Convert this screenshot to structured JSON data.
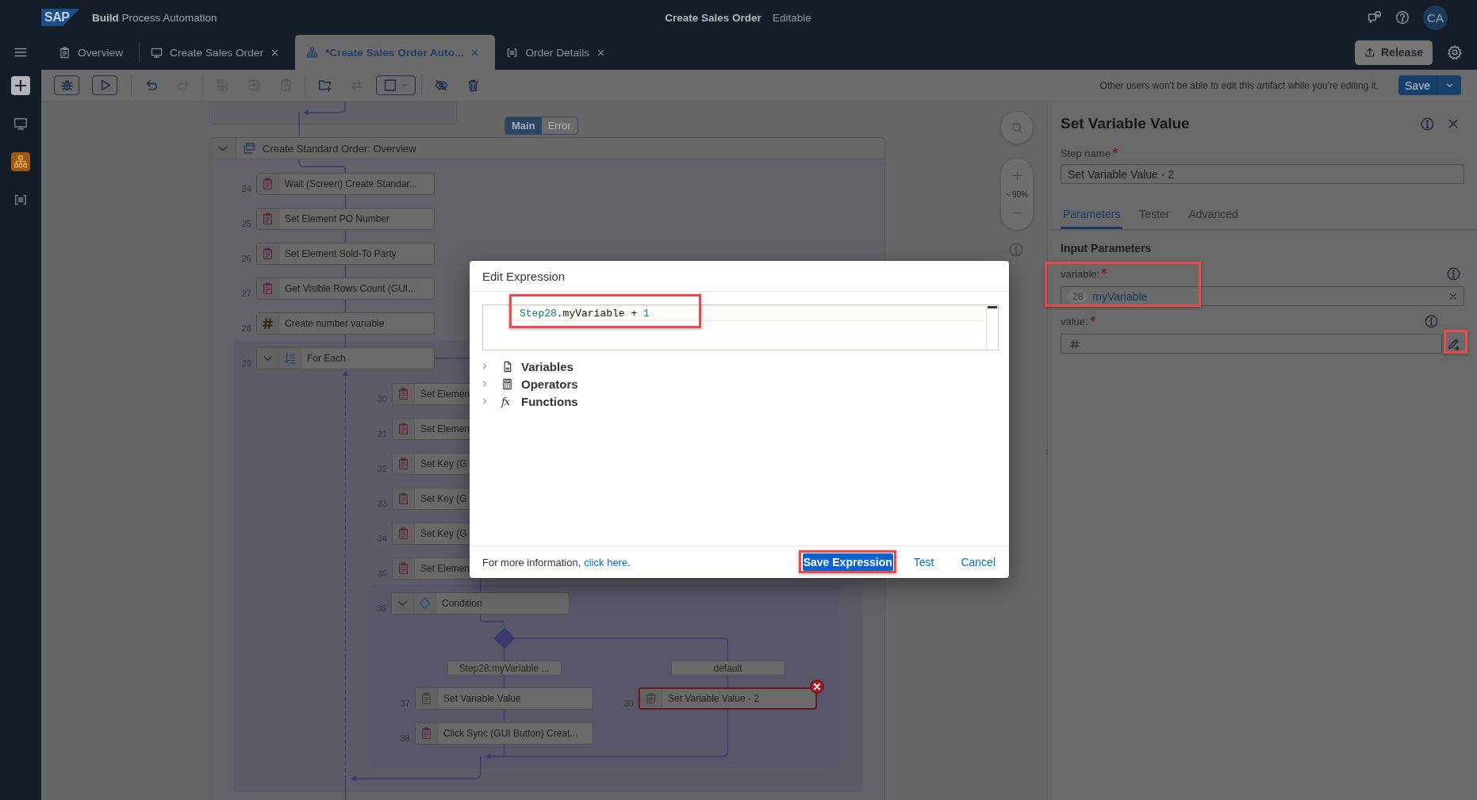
{
  "shell_bar": {
    "logo_text": "SAP",
    "product": "**Build** Process Automation",
    "document_title": "Create Sales Order",
    "document_status": "Editable",
    "user_initials": "CA"
  },
  "tabs": [
    {
      "label": "Overview",
      "kind": "overview",
      "selected": false,
      "closable": false
    },
    {
      "label": "Create Sales Order",
      "kind": "screen",
      "selected": false,
      "closable": true
    },
    {
      "label": "*Create Sales Order Auto...",
      "kind": "process",
      "selected": true,
      "closable": true
    },
    {
      "label": "Order Details",
      "kind": "data",
      "selected": false,
      "closable": true
    }
  ],
  "release_button": "Release",
  "sidebar": {
    "items": [
      {
        "kind": "add",
        "selected": false
      },
      {
        "kind": "screen",
        "selected": false
      },
      {
        "kind": "process",
        "selected": true
      },
      {
        "kind": "data",
        "selected": false
      }
    ]
  },
  "toolbar": {
    "groups": [
      [
        {
          "kind": "debug",
          "disabled": false
        },
        {
          "kind": "run",
          "disabled": false
        }
      ],
      [
        {
          "kind": "undo",
          "disabled": false
        },
        {
          "kind": "redo",
          "disabled": true
        }
      ],
      [
        {
          "kind": "copy",
          "disabled": true
        },
        {
          "kind": "duplicate",
          "disabled": true
        },
        {
          "kind": "paste",
          "disabled": true
        }
      ],
      [
        {
          "kind": "add_group",
          "disabled": false
        },
        {
          "kind": "swap",
          "disabled": true
        },
        {
          "kind": "select",
          "disabled": false
        }
      ],
      [
        {
          "kind": "hide",
          "disabled": false
        },
        {
          "kind": "delete",
          "disabled": false
        }
      ]
    ],
    "notice": "Other users won't be able to edit this artifact while you're editing it.",
    "save_button": "Save"
  },
  "canvas": {
    "view_switch": [
      {
        "label": "Main",
        "selected": true
      },
      {
        "label": "Error",
        "selected": false
      }
    ],
    "group": {
      "title": "Create Standard Order: Overview",
      "expanded": true,
      "steps": [
        {
          "number": "24",
          "kind": "activity",
          "label": "Wait (Screen) Create Standar..."
        },
        {
          "number": "25",
          "kind": "activity",
          "label": "Set Element PO Number"
        },
        {
          "number": "26",
          "kind": "activity",
          "label": "Set Element Sold-To Party"
        },
        {
          "number": "27",
          "kind": "activity",
          "label": "Get Visible Rows Count (GUI..."
        },
        {
          "number": "28",
          "kind": "variable",
          "label": "Create number variable"
        },
        {
          "number": "29",
          "kind": "loop",
          "label": "For Each",
          "expanded": true,
          "children": [
            {
              "number": "30",
              "kind": "activity",
              "label": "Set Elemen"
            },
            {
              "number": "31",
              "kind": "activity",
              "label": "Set Elemen"
            },
            {
              "number": "32",
              "kind": "activity",
              "label": "Set Key (G"
            },
            {
              "number": "33",
              "kind": "activity",
              "label": "Set Key (G"
            },
            {
              "number": "34",
              "kind": "activity",
              "label": "Set Key (G"
            },
            {
              "number": "35",
              "kind": "activity",
              "label": "Set Elemen"
            },
            {
              "number": "36",
              "kind": "condition",
              "label": "Condition",
              "expanded": true,
              "branches": [
                {
                  "label": "Step28.myVariable ...",
                  "steps": [
                    {
                      "number": "37",
                      "kind": "utility",
                      "label": "Set Variable Value",
                      "error": false
                    },
                    {
                      "number": "38",
                      "kind": "activity",
                      "label": "Click Sync (GUI Button) Creat...",
                      "error": false
                    }
                  ]
                },
                {
                  "label": "default",
                  "steps": [
                    {
                      "number": "39",
                      "kind": "utility",
                      "label": "Set Variable Value - 2",
                      "error": true
                    }
                  ]
                }
              ]
            }
          ]
        }
      ]
    },
    "zoom_level": "90%"
  },
  "properties": {
    "title": "Set Variable Value",
    "step_name": {
      "label": "Step name",
      "required": true,
      "value": "Set Variable Value - 2"
    },
    "tabs": [
      {
        "label": "Parameters",
        "selected": true
      },
      {
        "label": "Tester",
        "selected": false
      },
      {
        "label": "Advanced",
        "selected": false
      }
    ],
    "section_title": "Input Parameters",
    "params": [
      {
        "label": "variable:",
        "required": true,
        "kind": "variable",
        "token": "28",
        "value": "myVariable",
        "highlighted": true,
        "button_highlighted": false
      },
      {
        "label": "value:",
        "required": true,
        "kind": "expression",
        "highlighted": false,
        "button_highlighted": true
      }
    ]
  },
  "dialog": {
    "title": "Edit Expression",
    "expression": [
      {
        "text": "Step28",
        "kind": "reference"
      },
      {
        "text": ".myVariable + ",
        "kind": "plain"
      },
      {
        "text": "1",
        "kind": "number"
      }
    ],
    "expression_highlighted": true,
    "tree": [
      {
        "label": "Variables",
        "kind": "variables",
        "expanded": false
      },
      {
        "label": "Operators",
        "kind": "operators",
        "expanded": false
      },
      {
        "label": "Functions",
        "kind": "functions",
        "glyph": "fx",
        "expanded": false
      }
    ],
    "info_text": "For more information,",
    "info_link": "click here",
    "info_end": ".",
    "buttons": [
      {
        "label": "Save Expression",
        "kind": "emphasized",
        "highlighted": true
      },
      {
        "label": "Test",
        "kind": "transparent",
        "highlighted": false
      },
      {
        "label": "Cancel",
        "kind": "transparent",
        "highlighted": false
      }
    ]
  }
}
